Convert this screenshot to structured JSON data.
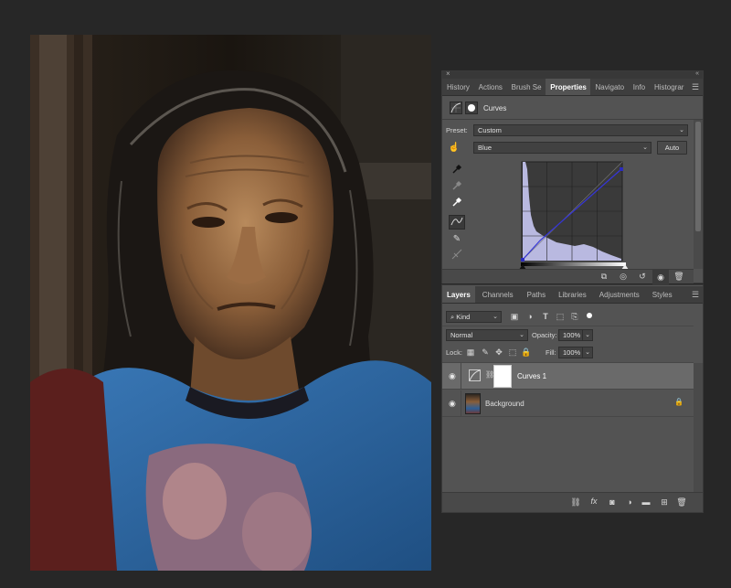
{
  "properties_panel": {
    "tabs": [
      "History",
      "Actions",
      "Brush Se",
      "Properties",
      "Navigato",
      "Info",
      "Histograr"
    ],
    "active_tab": "Properties",
    "title": "Curves",
    "preset_label": "Preset:",
    "preset_value": "Custom",
    "channel_value": "Blue",
    "auto_label": "Auto",
    "footer_icons": [
      "clip-to-layer-icon",
      "view-previous-icon",
      "reset-icon",
      "visibility-icon",
      "trash-icon"
    ]
  },
  "layers_panel": {
    "tabs": [
      "Layers",
      "Channels",
      "Paths",
      "Libraries",
      "Adjustments",
      "Styles"
    ],
    "active_tab": "Layers",
    "filter_value": "Kind",
    "blend_mode": "Normal",
    "opacity_label": "Opacity:",
    "opacity_value": "100%",
    "lock_label": "Lock:",
    "fill_label": "Fill:",
    "fill_value": "100%",
    "layers": [
      {
        "name": "Curves 1",
        "selected": true
      },
      {
        "name": "Background",
        "selected": false,
        "locked": true
      }
    ],
    "footer_icons": [
      "link-icon",
      "fx-icon",
      "mask-icon",
      "adjustment-icon",
      "folder-icon",
      "new-layer-icon",
      "trash-icon"
    ]
  },
  "colors": {
    "curve_line": "#3535d8",
    "histogram_fill": "#b9b9e0",
    "panel_bg": "#535353",
    "tab_bg": "#3e3e3e"
  }
}
